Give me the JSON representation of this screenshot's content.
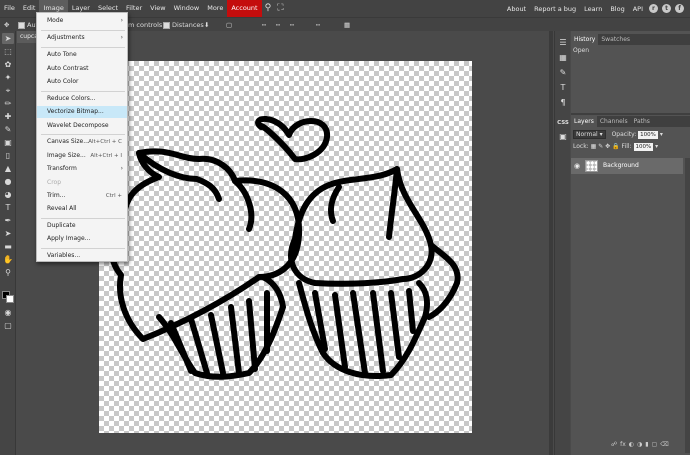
{
  "menubar": {
    "items": [
      "File",
      "Edit",
      "Image",
      "Layer",
      "Select",
      "Filter",
      "View",
      "Window",
      "More",
      "Account"
    ],
    "right_links": [
      "About",
      "Report a bug",
      "Learn",
      "Blog",
      "API"
    ]
  },
  "options_bar": {
    "auto_label": "Auto",
    "transform_controls": "m controls",
    "distances": "Distances"
  },
  "document": {
    "tab_name": "cupca"
  },
  "image_menu": {
    "items": [
      {
        "label": "Mode",
        "shortcut": "",
        "submenu": true
      },
      {
        "label": "Adjustments",
        "shortcut": "",
        "submenu": true
      },
      {
        "label": "Auto Tone",
        "shortcut": ""
      },
      {
        "label": "Auto Contrast",
        "shortcut": ""
      },
      {
        "label": "Auto Color",
        "shortcut": ""
      },
      {
        "label": "Reduce Colors...",
        "shortcut": ""
      },
      {
        "label": "Vectorize Bitmap...",
        "shortcut": "",
        "highlighted": true
      },
      {
        "label": "Wavelet Decompose",
        "shortcut": ""
      },
      {
        "label": "Canvas Size...",
        "shortcut": "Alt+Ctrl + C"
      },
      {
        "label": "Image Size...",
        "shortcut": "Alt+Ctrl + I"
      },
      {
        "label": "Transform",
        "shortcut": "",
        "submenu": true
      },
      {
        "label": "Crop",
        "shortcut": "",
        "disabled": true
      },
      {
        "label": "Trim...",
        "shortcut": "Ctrl +"
      },
      {
        "label": "Reveal All",
        "shortcut": ""
      },
      {
        "label": "Duplicate",
        "shortcut": ""
      },
      {
        "label": "Apply Image...",
        "shortcut": ""
      },
      {
        "label": "Variables...",
        "shortcut": ""
      }
    ]
  },
  "history_panel": {
    "tabs": [
      "History",
      "Swatches"
    ],
    "items": [
      "Open"
    ]
  },
  "minibar": {
    "css_label": "CSS"
  },
  "layers_panel": {
    "tabs": [
      "Layers",
      "Channels",
      "Paths"
    ],
    "blend_mode": "Normal",
    "opacity_label": "Opacity:",
    "opacity_value": "100%",
    "lock_label": "Lock:",
    "fill_label": "Fill:",
    "fill_value": "100%",
    "layers": [
      {
        "name": "Background",
        "visible": true
      }
    ],
    "footer_icons": [
      "link-icon",
      "effects-icon",
      "mask-icon",
      "adjustment-icon",
      "folder-icon",
      "new-layer-icon",
      "trash-icon"
    ]
  },
  "colors": {
    "account_bg": "#c40d0d",
    "menu_highlight": "#c8e8f8",
    "panel_bg": "#535353"
  }
}
